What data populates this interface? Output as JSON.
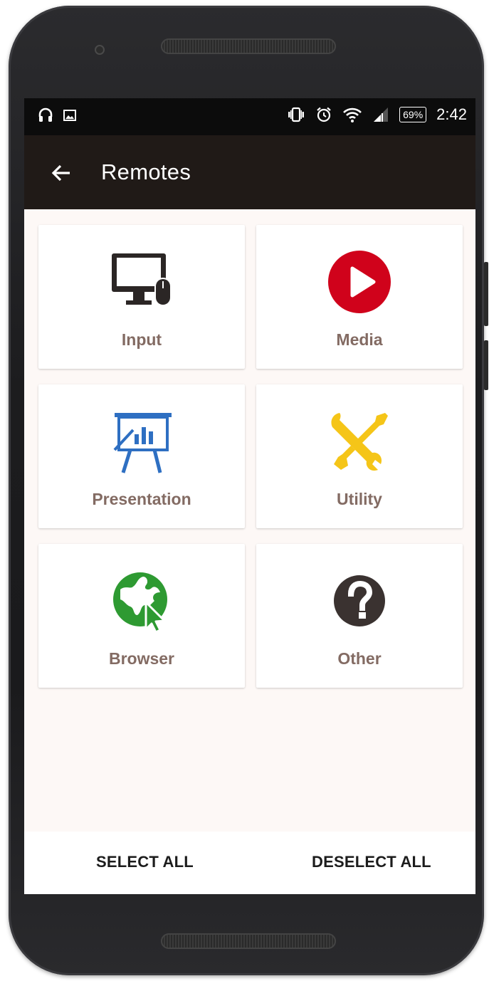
{
  "status_bar": {
    "battery": "69%",
    "time": "2:42",
    "left_icons": [
      "headphones-icon",
      "image-icon"
    ],
    "right_icons": [
      "vibrate-icon",
      "alarm-icon",
      "wifi-icon",
      "signal-icon",
      "battery-icon"
    ]
  },
  "app_bar": {
    "title": "Remotes",
    "background": "#201a17"
  },
  "tiles": [
    {
      "label": "Input",
      "icon": "monitor-mouse-icon",
      "color": "#2b2625"
    },
    {
      "label": "Media",
      "icon": "play-circle-icon",
      "color": "#d0021b"
    },
    {
      "label": "Presentation",
      "icon": "presentation-board-icon",
      "color": "#2e6fc2"
    },
    {
      "label": "Utility",
      "icon": "wrench-screwdriver-icon",
      "color": "#f5c518"
    },
    {
      "label": "Browser",
      "icon": "globe-cursor-icon",
      "color": "#2e9a32"
    },
    {
      "label": "Other",
      "icon": "question-circle-icon",
      "color": "#3a3230"
    }
  ],
  "bottom_bar": {
    "select_all": "SELECT ALL",
    "deselect_all": "DESELECT ALL"
  },
  "colors": {
    "label_text": "#836b63",
    "screen_background": "#fdf8f6"
  }
}
